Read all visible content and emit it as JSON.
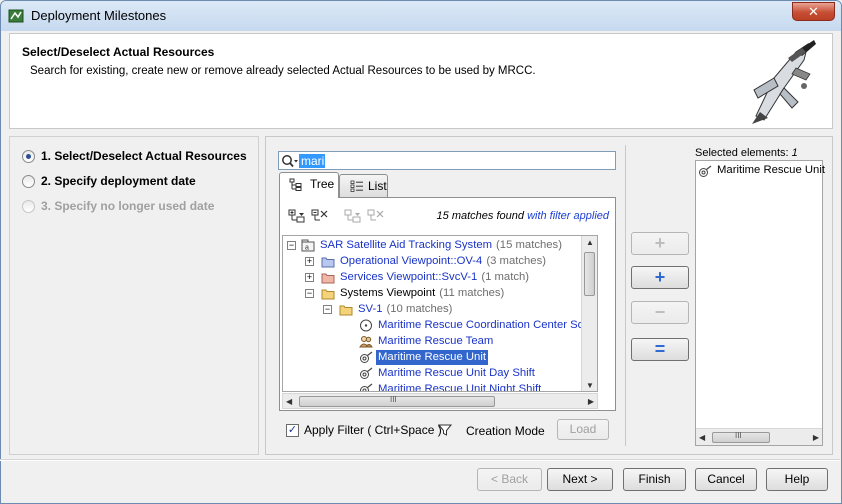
{
  "window": {
    "title": "Deployment Milestones",
    "close_glyph": "✕"
  },
  "header": {
    "title": "Select/Deselect Actual Resources",
    "description": "Search for existing, create new or remove already selected Actual Resources to be used by MRCC."
  },
  "steps": [
    {
      "label": "1. Select/Deselect Actual Resources",
      "state": "active"
    },
    {
      "label": "2. Specify deployment date",
      "state": "normal"
    },
    {
      "label": "3. Specify no longer used date",
      "state": "disabled"
    }
  ],
  "search": {
    "value": "mari"
  },
  "tabs": [
    {
      "label": "Tree",
      "selected": true
    },
    {
      "label": "List",
      "selected": false
    }
  ],
  "matches": {
    "count_text": "15 matches found",
    "filter_text": "with filter applied"
  },
  "tree": {
    "rows": [
      {
        "expander": "−",
        "icon": "package-icon",
        "label": "SAR Satellite Aid Tracking System",
        "count": "(15 matches)"
      },
      {
        "expander": "+",
        "icon": "folder-icon",
        "label": "Operational Viewpoint::OV-4",
        "count": "(3 matches)"
      },
      {
        "expander": "+",
        "icon": "folder-icon",
        "label": "Services Viewpoint::SvcV-1",
        "count": "(1 match)"
      },
      {
        "expander": "−",
        "icon": "folder-icon",
        "label": "Systems Viewpoint",
        "count": "(11 matches)"
      },
      {
        "expander": "−",
        "icon": "folder-icon",
        "label": "SV-1",
        "count": "(10 matches)"
      },
      {
        "expander": "",
        "icon": "circle-icon",
        "label": "Maritime Rescue Coordination Center Softwar",
        "count": ""
      },
      {
        "expander": "",
        "icon": "team-icon",
        "label": "Maritime Rescue Team",
        "count": ""
      },
      {
        "expander": "",
        "icon": "satellite-icon",
        "label": "Maritime Rescue Unit",
        "count": "",
        "selected": true
      },
      {
        "expander": "",
        "icon": "satellite-icon",
        "label": "Maritime Rescue Unit Day Shift",
        "count": ""
      },
      {
        "expander": "",
        "icon": "satellite-icon",
        "label": "Maritime Rescue Unit Night Shift",
        "count": ""
      }
    ]
  },
  "filter": {
    "apply_label": "Apply Filter ( Ctrl+Space )",
    "creation_mode_label": "Creation Mode",
    "load_label": "Load"
  },
  "selected": {
    "label": "Selected elements: ",
    "count": "1",
    "items": [
      "Maritime Rescue Unit"
    ]
  },
  "side_buttons": {
    "add": "+",
    "create": "+",
    "remove": "−",
    "remove_all": "="
  },
  "footer": {
    "back": "< Back",
    "next": "Next >",
    "finish": "Finish",
    "cancel": "Cancel",
    "help": "Help"
  },
  "scroll": {
    "thumb_grip": "III"
  }
}
